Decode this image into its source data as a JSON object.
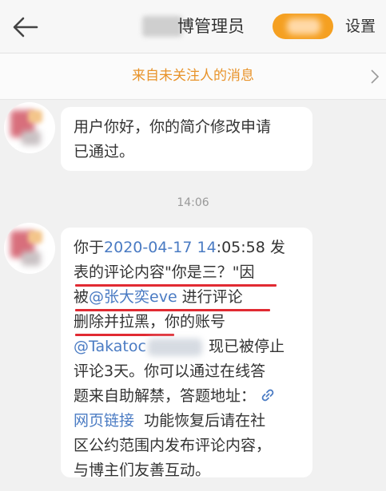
{
  "header": {
    "title_suffix": "博管理员",
    "settings_label": "设置"
  },
  "strangers_banner": {
    "label": "来自未关注人的消息"
  },
  "messages": [
    {
      "text_lines": [
        "用户你好，你的简介修改申请",
        "已通过。"
      ]
    },
    {
      "timestamp": "14:06",
      "line1_prefix": "你于",
      "line1_date": "2020-04-17",
      "line1_time_hl": "14",
      "line1_time_rest": ":05:58 发",
      "line2": "表的评论内容\"你是三？\"因",
      "line3_prefix": "被",
      "line3_mention": "@张大奕eve",
      "line3_suffix": " 进行评论",
      "line4_a": "删除并拉黑",
      "line4_b": "，你的账号",
      "line5_mention": "@Takatoc",
      "line5_suffix": " 现已被停止",
      "line6": "评论3天。你可以通过在线答",
      "line7": "题来自助解禁，答题地址：",
      "line8_link": "网页链接",
      "line8_suffix": "  功能恢复后请在社",
      "line9": "区公约范围内发布评论内容，",
      "line10": "与博主们友善互动。"
    }
  ],
  "colors": {
    "accent_orange": "#f5a021",
    "banner_text": "#e8932a",
    "link_blue": "#4a7bc3",
    "underline_red": "#e12a32"
  },
  "icons": {
    "back": "back-arrow-icon",
    "chevron": "chevron-right-icon",
    "link": "link-icon"
  }
}
